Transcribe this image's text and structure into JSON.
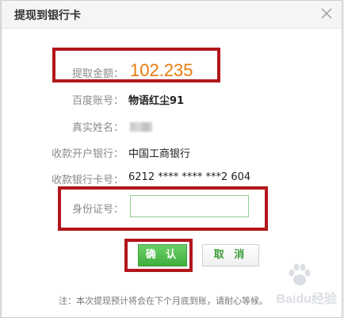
{
  "dialog": {
    "title": "提现到银行卡",
    "close_label": "×"
  },
  "fields": {
    "amount": {
      "label": "提取金额：",
      "value": "102.235"
    },
    "account": {
      "label": "百度账号：",
      "value": "物语红尘91"
    },
    "real_name": {
      "label": "真实姓名：",
      "value": ""
    },
    "bank": {
      "label": "收款开户银行：",
      "value": "中国工商银行"
    },
    "card_number": {
      "label": "收款银行卡号：",
      "value": "6212 **** **** ***2 604"
    },
    "id_number": {
      "label": "身份证号：",
      "value": "",
      "placeholder": ""
    }
  },
  "buttons": {
    "confirm": "确 认",
    "cancel": "取 消"
  },
  "note": "注：本次提现预计将会在下个月底到账，请耐心等候。",
  "watermark": {
    "text": "Baidu经验"
  },
  "colors": {
    "amount": "#e87b0c",
    "highlight_border": "#b2161b",
    "confirm_bg": "#4cb949",
    "input_border": "#8fcf8f"
  }
}
